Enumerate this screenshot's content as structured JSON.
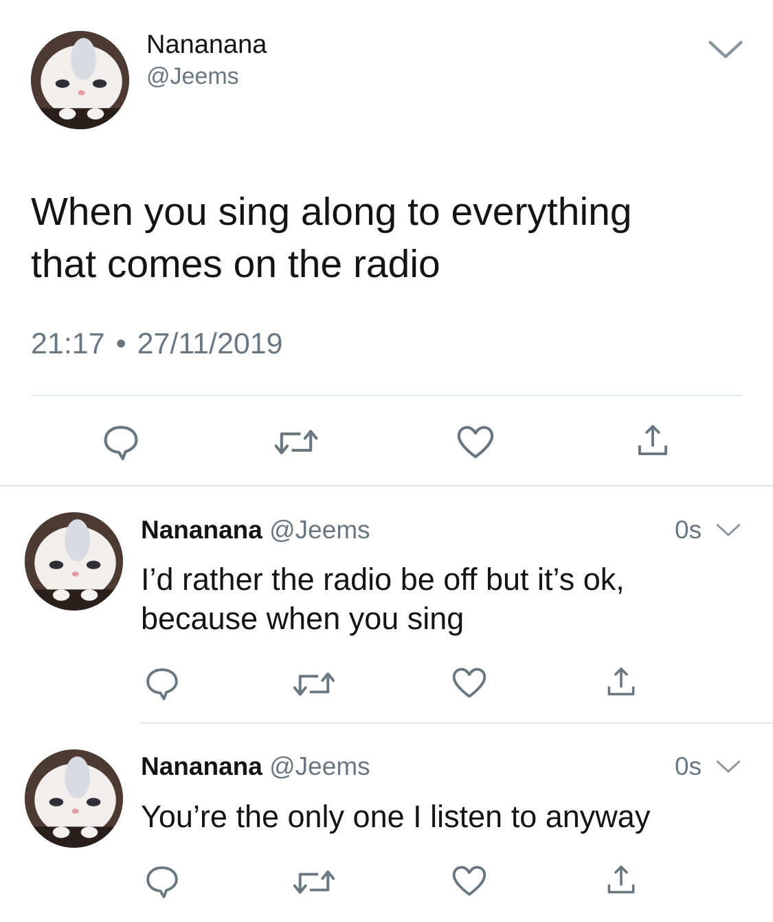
{
  "main_tweet": {
    "name": "Nananana",
    "handle": "@Jeems",
    "text_line1": "When you sing along to everything",
    "text_line2": "that comes on the radio",
    "time": "21:17",
    "separator": "•",
    "date": "27/11/2019"
  },
  "replies": [
    {
      "name": "Nananana",
      "handle": "@Jeems",
      "age": "0s",
      "text_line1": "I’d rather the radio be off but it’s ok,",
      "text_line2": "because when you sing"
    },
    {
      "name": "Nananana",
      "handle": "@Jeems",
      "age": "0s",
      "text_line1": "You’re the only one I listen to anyway",
      "text_line2": ""
    }
  ],
  "icons": {
    "reply": "reply-icon",
    "retweet": "retweet-icon",
    "like": "heart-icon",
    "share": "share-icon",
    "menu": "chevron-down-icon"
  },
  "colors": {
    "text": "#141414",
    "secondary": "#697780",
    "icon": "#697780",
    "divider": "#cfd6db"
  }
}
